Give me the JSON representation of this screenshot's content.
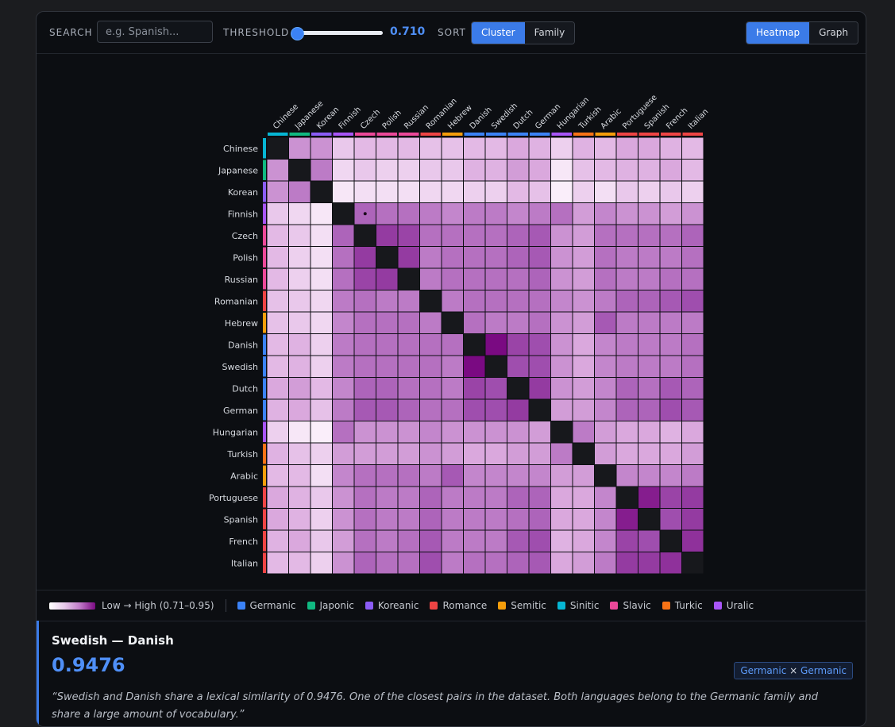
{
  "toolbar": {
    "search_label": "SEARCH",
    "search_placeholder": "e.g. Spanish...",
    "threshold_label": "THRESHOLD",
    "threshold_value": "0.710",
    "threshold_fraction": 0.0,
    "sort_label": "SORT",
    "sort_options": [
      "Cluster",
      "Family"
    ],
    "sort_active": "Cluster",
    "view_options": [
      "Heatmap",
      "Graph"
    ],
    "view_active": "Heatmap"
  },
  "families": [
    {
      "name": "Germanic",
      "color": "#3b82f6"
    },
    {
      "name": "Japonic",
      "color": "#10b981"
    },
    {
      "name": "Koreanic",
      "color": "#8b5cf6"
    },
    {
      "name": "Romance",
      "color": "#ef4444"
    },
    {
      "name": "Semitic",
      "color": "#f59e0b"
    },
    {
      "name": "Sinitic",
      "color": "#06b6d4"
    },
    {
      "name": "Slavic",
      "color": "#ec4899"
    },
    {
      "name": "Turkic",
      "color": "#f97316"
    },
    {
      "name": "Uralic",
      "color": "#a855f7"
    }
  ],
  "legend": {
    "scale_label": "Low → High (0.71–0.95)"
  },
  "chart_data": {
    "type": "heatmap",
    "languages": [
      "Chinese",
      "Japanese",
      "Korean",
      "Finnish",
      "Czech",
      "Polish",
      "Russian",
      "Romanian",
      "Hebrew",
      "Danish",
      "Swedish",
      "Dutch",
      "German",
      "Hungarian",
      "Turkish",
      "Arabic",
      "Portuguese",
      "Spanish",
      "French",
      "Italian"
    ],
    "language_family": [
      "Sinitic",
      "Japonic",
      "Koreanic",
      "Uralic",
      "Slavic",
      "Slavic",
      "Slavic",
      "Romance",
      "Semitic",
      "Germanic",
      "Germanic",
      "Germanic",
      "Germanic",
      "Uralic",
      "Turkic",
      "Semitic",
      "Romance",
      "Romance",
      "Romance",
      "Romance"
    ],
    "range": [
      0.71,
      0.95
    ],
    "highlight": [
      "Finnish",
      "Czech"
    ],
    "matrix": [
      [
        null,
        0.82,
        0.82,
        0.76,
        0.78,
        0.78,
        0.78,
        0.77,
        0.77,
        0.78,
        0.78,
        0.8,
        0.79,
        0.75,
        0.79,
        0.78,
        0.8,
        0.8,
        0.79,
        0.78
      ],
      [
        0.82,
        null,
        0.84,
        0.74,
        0.76,
        0.75,
        0.75,
        0.76,
        0.76,
        0.79,
        0.79,
        0.81,
        0.8,
        0.72,
        0.77,
        0.78,
        0.79,
        0.79,
        0.8,
        0.78
      ],
      [
        0.82,
        0.84,
        null,
        0.72,
        0.73,
        0.73,
        0.73,
        0.74,
        0.74,
        0.75,
        0.75,
        0.78,
        0.77,
        0.71,
        0.75,
        0.73,
        0.76,
        0.75,
        0.76,
        0.75
      ],
      [
        0.76,
        0.74,
        0.72,
        null,
        0.86,
        0.85,
        0.85,
        0.84,
        0.83,
        0.84,
        0.84,
        0.83,
        0.84,
        0.85,
        0.81,
        0.83,
        0.82,
        0.82,
        0.81,
        0.82
      ],
      [
        0.78,
        0.76,
        0.73,
        0.86,
        null,
        0.9,
        0.89,
        0.85,
        0.85,
        0.85,
        0.85,
        0.86,
        0.87,
        0.82,
        0.81,
        0.85,
        0.85,
        0.85,
        0.85,
        0.86
      ],
      [
        0.78,
        0.75,
        0.73,
        0.85,
        0.9,
        null,
        0.9,
        0.84,
        0.85,
        0.85,
        0.85,
        0.86,
        0.87,
        0.82,
        0.81,
        0.85,
        0.84,
        0.84,
        0.84,
        0.85
      ],
      [
        0.78,
        0.75,
        0.73,
        0.85,
        0.89,
        0.9,
        null,
        0.84,
        0.85,
        0.85,
        0.85,
        0.85,
        0.86,
        0.82,
        0.81,
        0.85,
        0.84,
        0.84,
        0.85,
        0.85
      ],
      [
        0.77,
        0.76,
        0.74,
        0.84,
        0.85,
        0.84,
        0.84,
        null,
        0.84,
        0.85,
        0.85,
        0.85,
        0.85,
        0.83,
        0.82,
        0.84,
        0.86,
        0.86,
        0.87,
        0.88
      ],
      [
        0.77,
        0.76,
        0.74,
        0.83,
        0.85,
        0.85,
        0.85,
        0.84,
        null,
        0.85,
        0.84,
        0.84,
        0.85,
        0.82,
        0.81,
        0.87,
        0.84,
        0.84,
        0.84,
        0.84
      ],
      [
        0.78,
        0.79,
        0.75,
        0.84,
        0.85,
        0.85,
        0.85,
        0.85,
        0.85,
        null,
        0.95,
        0.89,
        0.88,
        0.82,
        0.8,
        0.83,
        0.84,
        0.84,
        0.84,
        0.85
      ],
      [
        0.78,
        0.79,
        0.75,
        0.84,
        0.85,
        0.85,
        0.85,
        0.85,
        0.84,
        0.95,
        null,
        0.88,
        0.88,
        0.82,
        0.8,
        0.83,
        0.84,
        0.84,
        0.84,
        0.85
      ],
      [
        0.8,
        0.81,
        0.78,
        0.83,
        0.86,
        0.86,
        0.85,
        0.85,
        0.84,
        0.89,
        0.88,
        null,
        0.9,
        0.82,
        0.81,
        0.83,
        0.86,
        0.85,
        0.87,
        0.86
      ],
      [
        0.79,
        0.8,
        0.77,
        0.84,
        0.87,
        0.87,
        0.86,
        0.85,
        0.85,
        0.88,
        0.88,
        0.9,
        null,
        0.81,
        0.81,
        0.83,
        0.86,
        0.86,
        0.88,
        0.87
      ],
      [
        0.75,
        0.72,
        0.71,
        0.85,
        0.82,
        0.82,
        0.82,
        0.83,
        0.82,
        0.82,
        0.82,
        0.82,
        0.81,
        null,
        0.84,
        0.81,
        0.8,
        0.8,
        0.79,
        0.8
      ],
      [
        0.79,
        0.77,
        0.75,
        0.81,
        0.81,
        0.81,
        0.81,
        0.82,
        0.81,
        0.8,
        0.8,
        0.81,
        0.81,
        0.84,
        null,
        0.81,
        0.8,
        0.8,
        0.8,
        0.81
      ],
      [
        0.78,
        0.78,
        0.73,
        0.83,
        0.85,
        0.85,
        0.85,
        0.84,
        0.87,
        0.83,
        0.83,
        0.83,
        0.83,
        0.81,
        0.81,
        null,
        0.83,
        0.83,
        0.83,
        0.84
      ],
      [
        0.8,
        0.79,
        0.76,
        0.82,
        0.85,
        0.84,
        0.84,
        0.86,
        0.84,
        0.84,
        0.84,
        0.86,
        0.86,
        0.8,
        0.8,
        0.83,
        null,
        0.93,
        0.89,
        0.9
      ],
      [
        0.8,
        0.79,
        0.75,
        0.82,
        0.85,
        0.84,
        0.84,
        0.86,
        0.84,
        0.84,
        0.84,
        0.85,
        0.86,
        0.8,
        0.8,
        0.83,
        0.93,
        null,
        0.88,
        0.9
      ],
      [
        0.79,
        0.8,
        0.76,
        0.81,
        0.85,
        0.84,
        0.85,
        0.87,
        0.84,
        0.84,
        0.84,
        0.87,
        0.88,
        0.79,
        0.8,
        0.83,
        0.89,
        0.88,
        null,
        0.91
      ],
      [
        0.78,
        0.78,
        0.75,
        0.82,
        0.86,
        0.85,
        0.85,
        0.88,
        0.84,
        0.85,
        0.85,
        0.86,
        0.87,
        0.8,
        0.81,
        0.84,
        0.9,
        0.9,
        0.91,
        null
      ]
    ]
  },
  "detail": {
    "title": "Swedish — Danish",
    "score": "0.9476",
    "family_a": "Germanic",
    "cross": "×",
    "family_b": "Germanic",
    "quote": "“Swedish and Danish share a lexical similarity of 0.9476. One of the closest pairs in the dataset. Both languages belong to the Germanic family and share a large amount of vocabulary.”"
  }
}
